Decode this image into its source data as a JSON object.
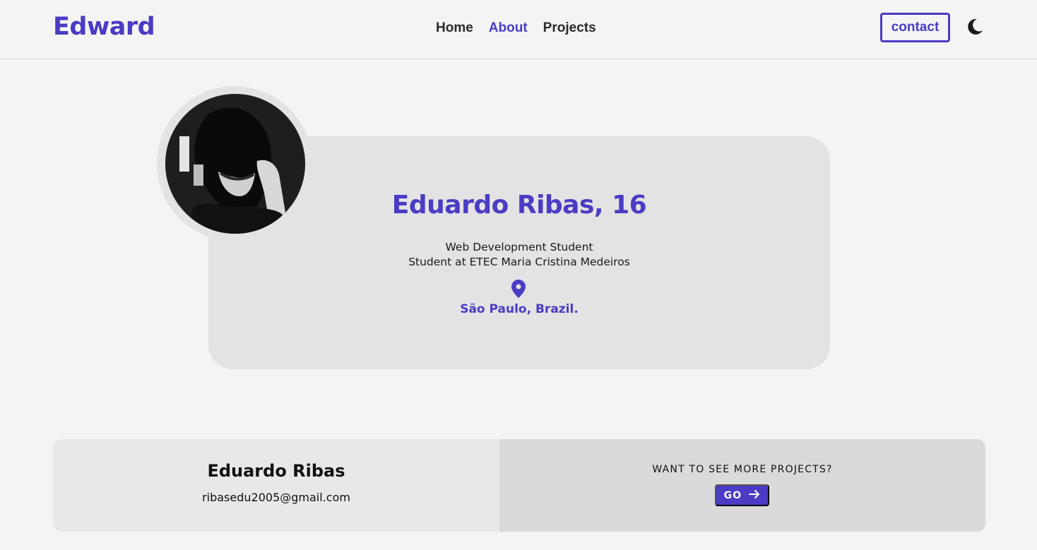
{
  "header": {
    "logo": "Edward",
    "nav": [
      {
        "label": "Home",
        "active": false
      },
      {
        "label": "About",
        "active": true
      },
      {
        "label": "Projects",
        "active": false
      }
    ],
    "contact_label": "contact",
    "theme_icon": "moon-icon"
  },
  "profile": {
    "name": "Eduardo Ribas, 16",
    "role": "Web Development Student",
    "school": "Student at ETEC Maria Cristina Medeiros",
    "location_icon": "map-pin-icon",
    "location": "São Paulo, Brazil."
  },
  "footer": {
    "name": "Eduardo Ribas",
    "email": "ribasedu2005@gmail.com",
    "cta_text": "WANT TO SEE MORE PROJECTS?",
    "go_label": "GO",
    "go_icon": "arrow-right-icon"
  },
  "colors": {
    "accent": "#4a3cc4",
    "background": "#f4f4f4",
    "card": "#e3e3e3"
  }
}
